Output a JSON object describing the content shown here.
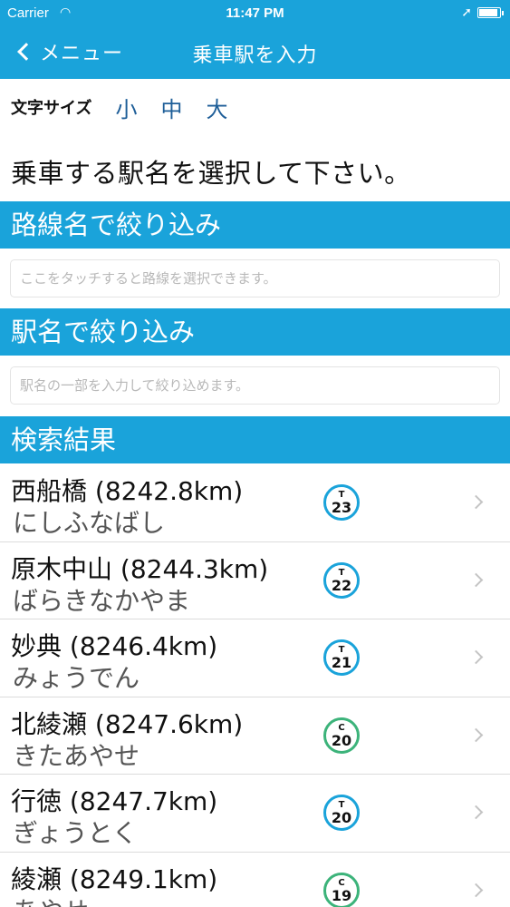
{
  "status_bar": {
    "carrier": "Carrier",
    "time": "11:47 PM",
    "battery_level": 0.9
  },
  "nav": {
    "back_label": "メニュー",
    "title": "乗車駅を入力"
  },
  "font_size": {
    "label": "文字サイズ",
    "options": [
      "小",
      "中",
      "大"
    ]
  },
  "instruction": "乗車する駅名を選択して下さい。",
  "line_filter": {
    "header": "路線名で絞り込み",
    "placeholder": "ここをタッチすると路線を選択できます。"
  },
  "station_filter": {
    "header": "駅名で絞り込み",
    "placeholder": "駅名の一部を入力して絞り込めます。"
  },
  "results": {
    "header": "検索結果",
    "items": [
      {
        "name": "西船橋 (8242.8km)",
        "kana": "にしふなばし",
        "line_code": "T",
        "station_number": "23",
        "line_color": "#1aa3da"
      },
      {
        "name": "原木中山 (8244.3km)",
        "kana": "ばらきなかやま",
        "line_code": "T",
        "station_number": "22",
        "line_color": "#1aa3da"
      },
      {
        "name": "妙典 (8246.4km)",
        "kana": "みょうでん",
        "line_code": "T",
        "station_number": "21",
        "line_color": "#1aa3da"
      },
      {
        "name": "北綾瀬 (8247.6km)",
        "kana": "きたあやせ",
        "line_code": "C",
        "station_number": "20",
        "line_color": "#3cb37a"
      },
      {
        "name": "行徳 (8247.7km)",
        "kana": "ぎょうとく",
        "line_code": "T",
        "station_number": "20",
        "line_color": "#1aa3da"
      },
      {
        "name": "綾瀬 (8249.1km)",
        "kana": "あやせ",
        "line_code": "C",
        "station_number": "19",
        "line_color": "#3cb37a"
      }
    ]
  }
}
